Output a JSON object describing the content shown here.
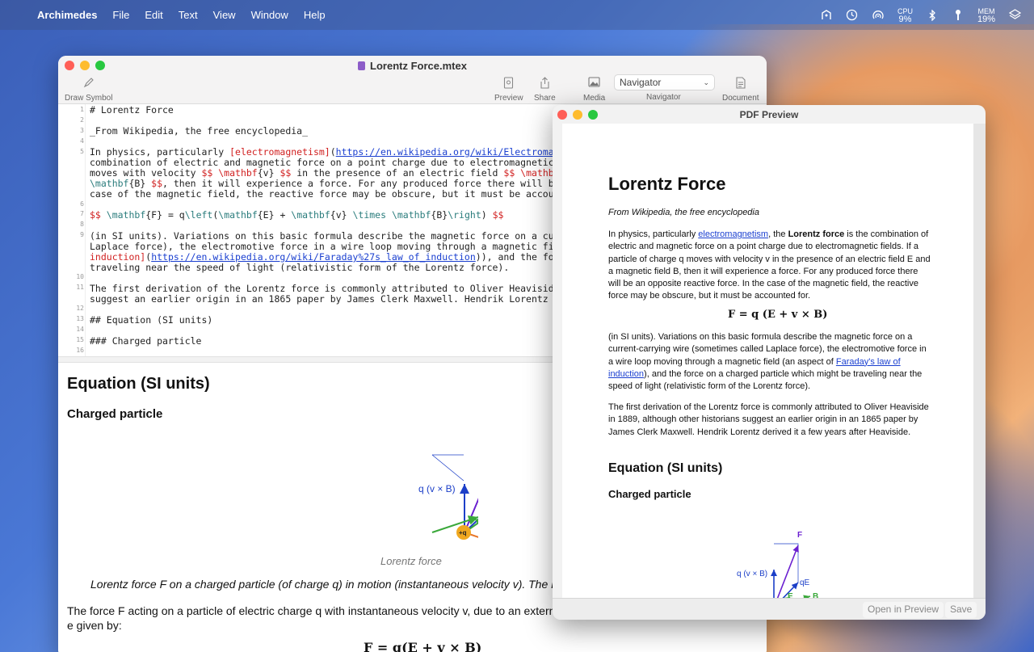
{
  "menubar": {
    "app_name": "Archimedes",
    "items": [
      "File",
      "Edit",
      "Text",
      "View",
      "Window",
      "Help"
    ],
    "cpu_label": "CPU",
    "cpu_value": "9%",
    "mem_label": "MEM",
    "mem_value": "19%"
  },
  "main_window": {
    "title": "Lorentz Force.mtex",
    "toolbar": {
      "draw_symbol": "Draw Symbol",
      "preview": "Preview",
      "share": "Share",
      "media": "Media",
      "navigator_select": "Navigator",
      "navigator_label": "Navigator",
      "document": "Document"
    },
    "line_numbers": [
      "1",
      "2",
      "3",
      "4",
      "5",
      "",
      "",
      "",
      "",
      "6",
      "7",
      "8",
      "9",
      "",
      "",
      "",
      "10",
      "11",
      "",
      "12",
      "13",
      "14",
      "15",
      "16"
    ],
    "code": {
      "l1": "# Lorentz Force",
      "l3": "_From Wikipedia, the free encyclopedia_",
      "l5a": "In physics, particularly ",
      "l5b": "[electromagnetism]",
      "l5c": "(",
      "l5d": "https://en.wikipedia.org/wiki/Electromagne",
      "l5e": "combination of electric and magnetic force on a point charge due to electromagnetic f",
      "l5f1": "moves with velocity ",
      "l5f2": "$$ \\mathbf",
      "l5f3": "{v} ",
      "l5f4": "$$",
      "l5f5": " in the presence of an electric field ",
      "l5f6": "$$ \\mathbf",
      "l5f7": "{",
      "l5g1": "\\mathbf",
      "l5g2": "{B} ",
      "l5g3": "$$",
      "l5g4": ", then it will experience a force. For any produced force there will be",
      "l5h": "case of the magnetic field, the reactive force may be obscure, but it must be account",
      "l7a": "$$",
      "l7b": " \\mathbf",
      "l7c": "{F} = q",
      "l7d": "\\left",
      "l7e": "(",
      "l7f": "\\mathbf",
      "l7g": "{E} + ",
      "l7h": "\\mathbf",
      "l7i": "{v} ",
      "l7j": "\\times",
      "l7k": " ",
      "l7l": "\\mathbf",
      "l7m": "{B}",
      "l7n": "\\right",
      "l7o": ") ",
      "l7p": "$$",
      "l9a": "(in SI units). Variations on this basic formula describe the magnetic force on a curr",
      "l9b": "Laplace force), the electromotive force in a wire loop moving through a magnetic fiel",
      "l9c1": "induction]",
      "l9c2": "(",
      "l9c3": "https://en.wikipedia.org/wiki/Faraday%27s_law_of_induction",
      "l9c4": ")), and the forc",
      "l9d": "traveling near the speed of light (relativistic form of the Lorentz force).",
      "l11a": "The first derivation of the Lorentz force is commonly attributed to Oliver Heaviside",
      "l11b": "suggest an earlier origin in an 1865 paper by James Clerk Maxwell. Hendrik Lorentz de",
      "l13": "## Equation (SI units)",
      "l15": "### Charged particle"
    },
    "preview": {
      "h2": "Equation (SI units)",
      "h3": "Charged particle",
      "caption": "Lorentz force",
      "para1": "Lorentz force F on a charged particle (of charge q) in motion (instantaneous velocity v). The E fi",
      "para2": "The force F acting on a particle of electric charge q with instantaneous velocity v, due to an external e given by:",
      "equation": "F = q(E + v × B)"
    }
  },
  "pdf_window": {
    "title": "PDF Preview",
    "h1": "Lorentz Force",
    "subtitle": "From Wikipedia, the free encyclopedia",
    "p1_a": "In physics, particularly ",
    "p1_link": "electromagnetism",
    "p1_b": ", the ",
    "p1_bold": "Lorentz force",
    "p1_c": " is the combination of electric and magnetic force on a point charge due to electromagnetic fields. If a particle of charge q moves with velocity v in the presence of an electric field E and a magnetic field B, then it will experience a force. For any produced force there will be an opposite reactive force. In the case of the magnetic field, the reactive force may be obscure, but it must be accounted for.",
    "equation": "F = q (E + v × B)",
    "p2_a": "(in SI units). Variations on this basic formula describe the magnetic force on a current-carrying wire (sometimes called Laplace force), the electromotive force in a wire loop moving through a magnetic field (an aspect of ",
    "p2_link": "Faraday's law of induction",
    "p2_b": "), and the force on a charged particle which might be traveling near the speed of light (relativistic form of the Lorentz force).",
    "p3": "The first derivation of the Lorentz force is commonly attributed to Oliver Heaviside in 1889, although other historians suggest an earlier origin in an 1865 paper by James Clerk Maxwell. Hendrik Lorentz derived it a few years after Heaviside.",
    "h2": "Equation (SI units)",
    "h3": "Charged particle",
    "open_button": "Open in Preview",
    "save_button": "Save"
  },
  "diagram": {
    "label_F": "F",
    "label_qvB": "q (v × B)",
    "label_qE": "qE",
    "label_E": "E",
    "label_B": "B",
    "label_theta": "θ",
    "label_q": "+q",
    "label_v": "v"
  },
  "colors": {
    "force": "#6a1fd0",
    "qvB": "#1c3fc8",
    "E": "#3aa83a",
    "B": "#3aa83a",
    "v": "#e8772a",
    "charge": "#f0a820"
  }
}
